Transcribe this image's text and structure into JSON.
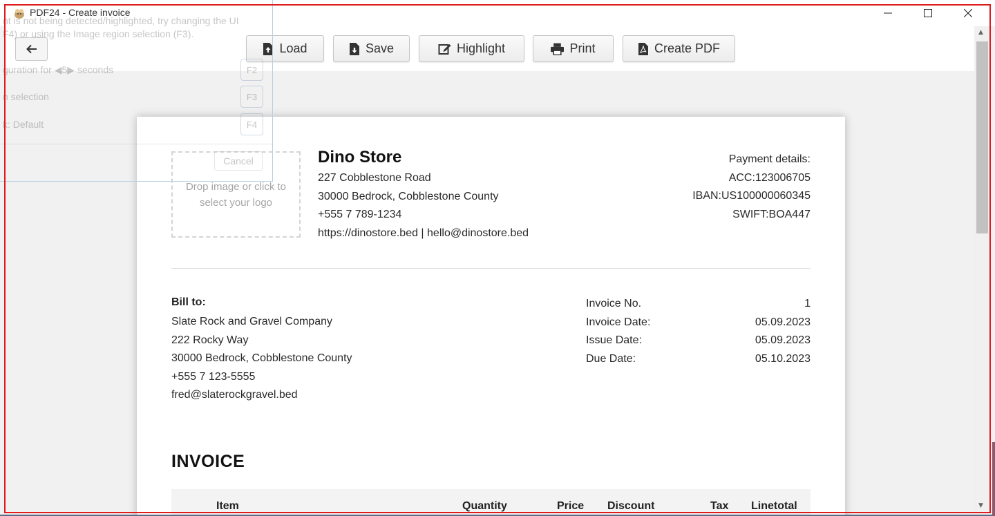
{
  "window": {
    "title": "PDF24 - Create invoice",
    "controls": {
      "minimize": "—",
      "maximize": "☐",
      "close": "✕"
    }
  },
  "toolbar": {
    "back_icon": "←",
    "buttons": [
      {
        "label": "Load",
        "icon": "file-upload-icon"
      },
      {
        "label": "Save",
        "icon": "file-download-icon"
      },
      {
        "label": "Highlight",
        "icon": "edit-icon"
      },
      {
        "label": "Print",
        "icon": "print-icon"
      },
      {
        "label": "Create PDF",
        "icon": "pdf-file-icon"
      }
    ]
  },
  "ghost_overlay": {
    "line1": "nt is not being detected/highlighted, try changing the UI",
    "line2": "F4) or using the Image region selection (F3).",
    "line3_prefix": "guration for",
    "line3_value": "5",
    "line3_suffix": "seconds",
    "line4": "n selection",
    "line5": "k: Default",
    "keys": [
      "F2",
      "F3",
      "F4"
    ],
    "cancel": "Cancel"
  },
  "invoice": {
    "logo_placeholder": "Drop image or click to select your logo",
    "store": {
      "name": "Dino Store",
      "address1": "227 Cobblestone Road",
      "address2": "30000 Bedrock, Cobblestone County",
      "phone": "+555 7 789-1234",
      "web_email": "https://dinostore.bed | hello@dinostore.bed"
    },
    "payment": {
      "title": "Payment details:",
      "acc": "ACC:123006705",
      "iban": "IBAN:US100000060345",
      "swift": "SWIFT:BOA447"
    },
    "bill_to": {
      "title": "Bill to:",
      "name": "Slate Rock and Gravel Company",
      "address1": "222 Rocky Way",
      "address2": "30000 Bedrock, Cobblestone County",
      "phone": "+555 7 123-5555",
      "email": "fred@slaterockgravel.bed"
    },
    "meta": [
      {
        "label": "Invoice No.",
        "value": "1"
      },
      {
        "label": "Invoice Date:",
        "value": "05.09.2023"
      },
      {
        "label": "Issue Date:",
        "value": "05.09.2023"
      },
      {
        "label": "Due Date:",
        "value": "05.10.2023"
      }
    ],
    "heading": "INVOICE",
    "table_headers": [
      "Item",
      "Quantity",
      "Price",
      "Discount",
      "Tax",
      "Linetotal"
    ]
  },
  "colors": {
    "highlight_border": "#e01b1b",
    "page_bg": "#ffffff",
    "app_bg": "#f1f1f1"
  }
}
